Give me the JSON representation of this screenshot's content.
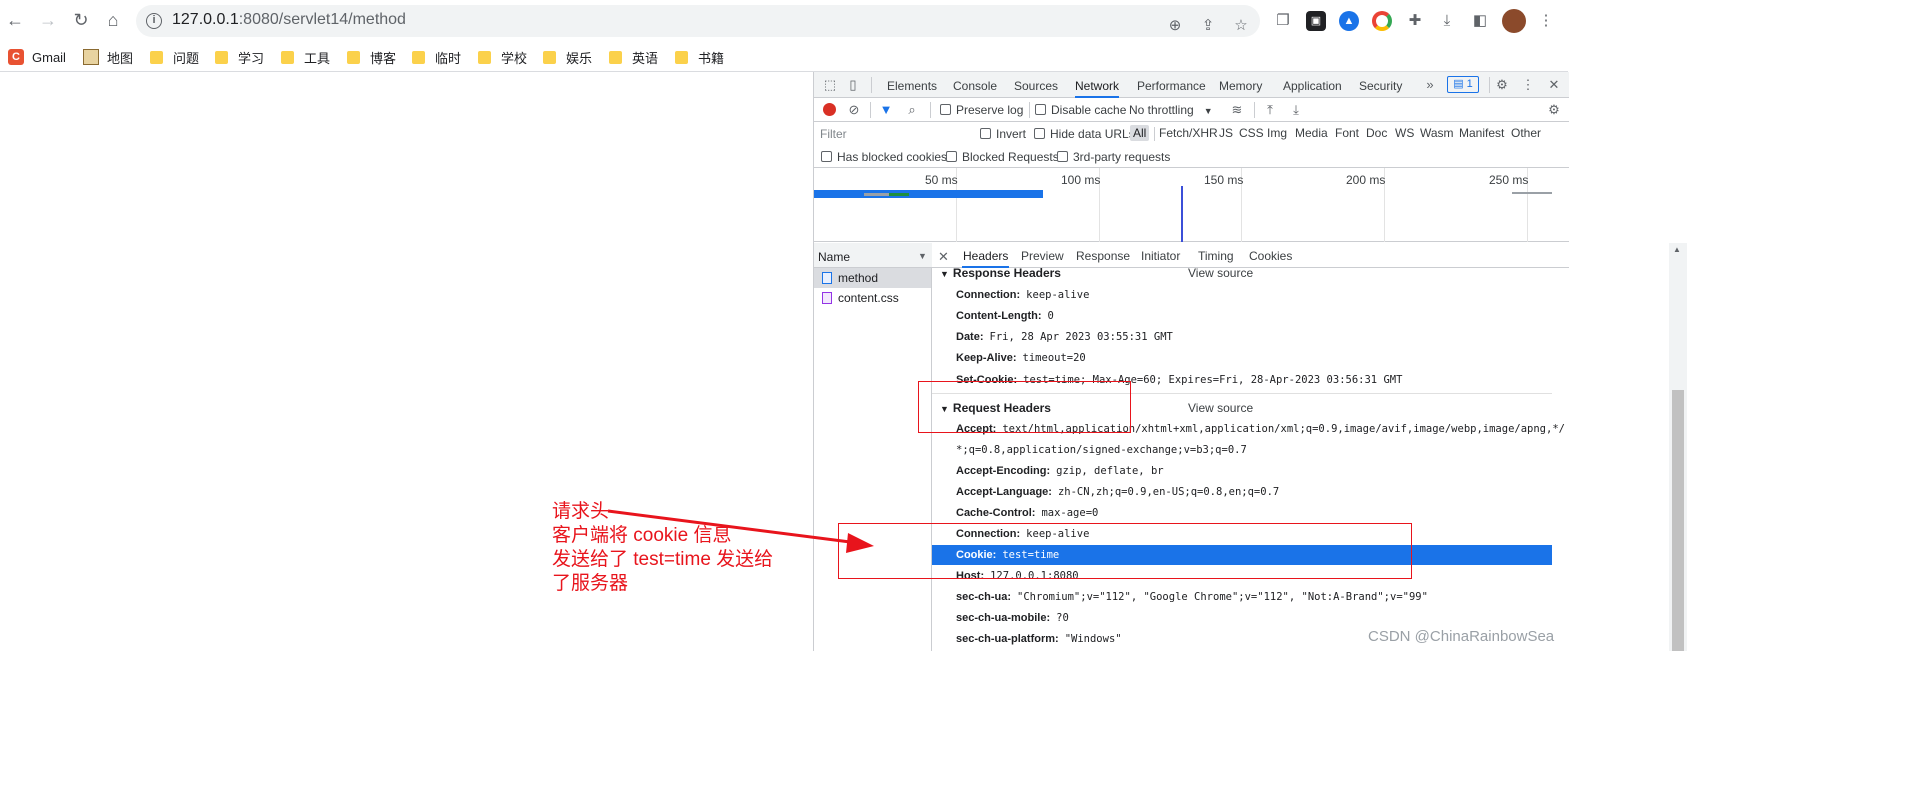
{
  "browser": {
    "url_host": "127.0.0.1",
    "url_rest": ":8080/servlet14/method",
    "bookmarks": [
      "Gmail",
      "地图",
      "问题",
      "学习",
      "工具",
      "博客",
      "临时",
      "学校",
      "娱乐",
      "英语",
      "书籍"
    ]
  },
  "devtools": {
    "tabs": [
      "Elements",
      "Console",
      "Sources",
      "Network",
      "Performance",
      "Memory",
      "Application",
      "Security"
    ],
    "active_tab": "Network",
    "issues_count": "1",
    "toolbar": {
      "preserve_log": "Preserve log",
      "disable_cache": "Disable cache",
      "throttling": "No throttling"
    },
    "filter": {
      "placeholder": "Filter",
      "invert": "Invert",
      "hide_data_urls": "Hide data URLs",
      "types": [
        "All",
        "Fetch/XHR",
        "JS",
        "CSS",
        "Img",
        "Media",
        "Font",
        "Doc",
        "WS",
        "Wasm",
        "Manifest",
        "Other"
      ],
      "has_blocked_cookies": "Has blocked cookies",
      "blocked_requests": "Blocked Requests",
      "third_party": "3rd-party requests"
    },
    "timeline_ticks": [
      "50 ms",
      "100 ms",
      "150 ms",
      "200 ms",
      "250 ms"
    ],
    "request_list": {
      "header": "Name",
      "requests": [
        "method",
        "content.css"
      ]
    },
    "detail_tabs": [
      "Headers",
      "Preview",
      "Response",
      "Initiator",
      "Timing",
      "Cookies"
    ],
    "response_headers": {
      "title": "Response Headers",
      "view_source": "View source",
      "rows": [
        {
          "k": "Connection:",
          "v": "keep-alive"
        },
        {
          "k": "Content-Length:",
          "v": "0"
        },
        {
          "k": "Date:",
          "v": "Fri, 28 Apr 2023 03:55:31 GMT"
        },
        {
          "k": "Keep-Alive:",
          "v": "timeout=20"
        },
        {
          "k": "Set-Cookie:",
          "v": "test=time; Max-Age=60; Expires=Fri, 28-Apr-2023 03:56:31 GMT"
        }
      ]
    },
    "request_headers": {
      "title": "Request Headers",
      "view_source": "View source",
      "accept_k": "Accept:",
      "accept_v1": "text/html,application/xhtml+xml,application/xml;q=0.9,image/avif,image/webp,image/apng,*/",
      "accept_v2": "*;q=0.8,application/signed-exchange;v=b3;q=0.7",
      "rows": [
        {
          "k": "Accept-Encoding:",
          "v": "gzip, deflate, br"
        },
        {
          "k": "Accept-Language:",
          "v": "zh-CN,zh;q=0.9,en-US;q=0.8,en;q=0.7"
        },
        {
          "k": "Cache-Control:",
          "v": "max-age=0"
        },
        {
          "k": "Connection:",
          "v": "keep-alive"
        },
        {
          "k": "Cookie:",
          "v": "test=time"
        },
        {
          "k": "Host:",
          "v": "127.0.0.1:8080"
        },
        {
          "k": "sec-ch-ua:",
          "v": "\"Chromium\";v=\"112\", \"Google Chrome\";v=\"112\", \"Not:A-Brand\";v=\"99\""
        },
        {
          "k": "sec-ch-ua-mobile:",
          "v": "?0"
        },
        {
          "k": "sec-ch-ua-platform:",
          "v": "\"Windows\""
        }
      ]
    }
  },
  "annotation": {
    "lines": [
      "请求头",
      "客户端将 cookie 信息",
      "发送给了 test=time 发送给",
      "了服务器"
    ]
  },
  "watermark": "CSDN @ChinaRainbowSea",
  "colors": {
    "accent": "#1a73e8",
    "annotation": "#e8141c",
    "highlight": "#1a73e8"
  }
}
